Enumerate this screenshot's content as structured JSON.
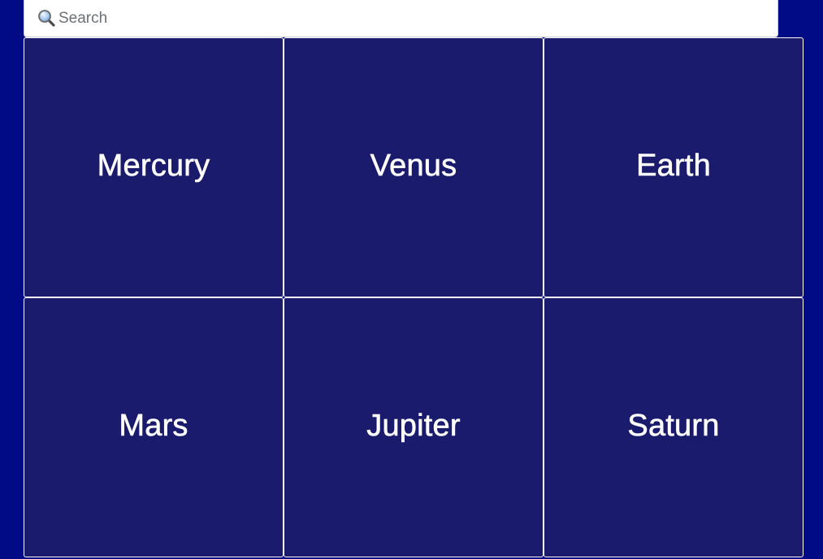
{
  "search": {
    "placeholder": "Search",
    "value": "",
    "icon": "magnifying-glass-icon"
  },
  "planets": [
    {
      "label": "Mercury"
    },
    {
      "label": "Venus"
    },
    {
      "label": "Earth"
    },
    {
      "label": "Mars"
    },
    {
      "label": "Jupiter"
    },
    {
      "label": "Saturn"
    }
  ],
  "colors": {
    "page_background": "#020b86",
    "tile_background": "#1a1b6c",
    "tile_border": "#ffffff",
    "tile_text": "#ffffff",
    "search_background": "#ffffff"
  }
}
